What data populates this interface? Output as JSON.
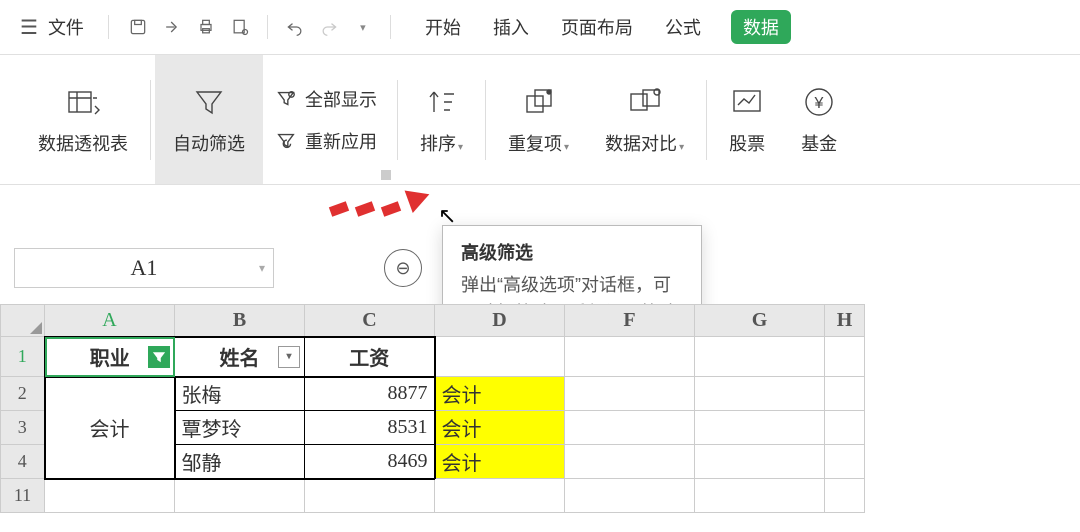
{
  "titlebar": {
    "file_label": "文件"
  },
  "tabs": {
    "start": "开始",
    "insert": "插入",
    "pagelayout": "页面布局",
    "formula": "公式",
    "data": "数据"
  },
  "ribbon": {
    "pivot": "数据透视表",
    "autofilter": "自动筛选",
    "showall": "全部显示",
    "reapply": "重新应用",
    "sort": "排序",
    "dup": "重复项",
    "compare": "数据对比",
    "stock": "股票",
    "fund": "基金"
  },
  "namebox": {
    "value": "A1"
  },
  "columns": [
    "A",
    "B",
    "C",
    "D",
    "F",
    "G",
    "H"
  ],
  "rows": [
    "1",
    "2",
    "3",
    "4",
    "11"
  ],
  "table": {
    "header": {
      "a": "职业",
      "b": "姓名",
      "c": "工资"
    },
    "a_merged": "会计",
    "body": [
      {
        "b": "张梅",
        "c": "8877",
        "d": "会计"
      },
      {
        "b": "覃梦玲",
        "c": "8531",
        "d": "会计"
      },
      {
        "b": "邹静",
        "c": "8469",
        "d": "会计"
      }
    ]
  },
  "tooltip": {
    "title": "高级筛选",
    "body": "弹出“高级选项”对话框，可以选择筛选不重复记录等选项。"
  }
}
